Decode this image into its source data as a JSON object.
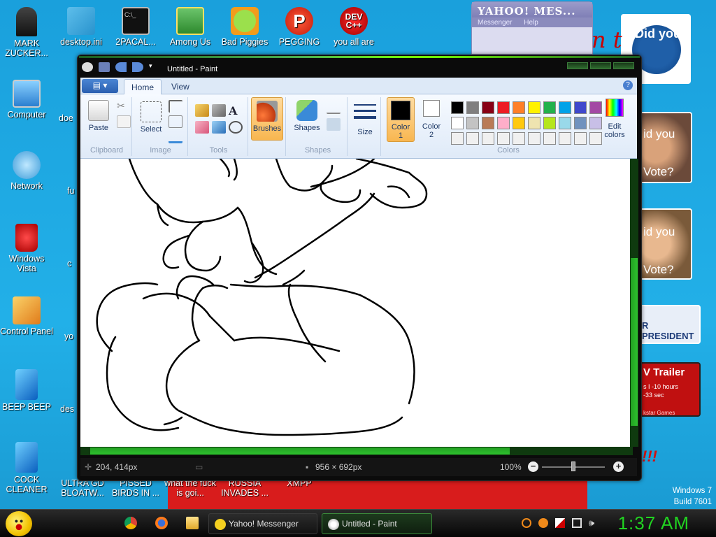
{
  "desktop": {
    "icons": [
      {
        "label": "MARK ZUCKER...",
        "icon": "user-icon"
      },
      {
        "label": "desktop.ini",
        "icon": "file-icon"
      },
      {
        "label": "2PACAL...",
        "icon": "console-icon"
      },
      {
        "label": "Among Us",
        "icon": "game-icon"
      },
      {
        "label": "Bad Piggies",
        "icon": "pig-icon"
      },
      {
        "label": "PEGGING",
        "icon": "p-icon"
      },
      {
        "label": "you all are",
        "icon": "devcpp-icon"
      },
      {
        "label": "Computer",
        "icon": "computer-icon"
      },
      {
        "label": "Network",
        "icon": "network-icon"
      },
      {
        "label": "Windows Vista",
        "icon": "recycle-bin-icon"
      },
      {
        "label": "Control Panel",
        "icon": "control-panel-icon"
      },
      {
        "label": "BEEP BEEP",
        "icon": "blue-file-icon"
      },
      {
        "label": "COCK CLEANER",
        "icon": "blue-file-icon"
      }
    ],
    "partial_icons": [
      {
        "label": "doe"
      },
      {
        "label": "fu"
      },
      {
        "label": "c"
      },
      {
        "label": "yo"
      },
      {
        "label": "des"
      }
    ],
    "bottom_labels": [
      "ULTRA GD BLOATW...",
      "PISSED BIRDS IN ...",
      "what the fuck is goi...",
      "RUSSIA INVADES ...",
      "XMPP"
    ],
    "ads": {
      "did_you_1": "Did you",
      "did_you_2": "id you",
      "vote_2": "Vote?",
      "did_you_3": "id you",
      "vote_3": "Vote?",
      "president": "R PRESIDENT",
      "trailer": "V Trailer",
      "trailer_sub1": "s I -10 hours",
      "trailer_sub2": "-33 sec",
      "trailer_sub3": "kstar Games"
    },
    "watermark": {
      "line1": "Windows 7",
      "line2": "Build 7601"
    }
  },
  "yahoo": {
    "title": "YAHOO! MES...",
    "menu": [
      "Messenger",
      "Help"
    ]
  },
  "paint": {
    "title": "Untitled - Paint",
    "tabs": [
      "Home",
      "View"
    ],
    "groups": {
      "clipboard": {
        "label": "Clipboard",
        "paste": "Paste"
      },
      "image": {
        "label": "Image",
        "select": "Select"
      },
      "tools": {
        "label": "Tools"
      },
      "brushes": {
        "label": "Brushes"
      },
      "shapes": {
        "label": "Shapes",
        "shapes_btn": "Shapes"
      },
      "size": {
        "label": "Size"
      },
      "colors": {
        "label": "Colors",
        "color1_a": "Color",
        "color1_b": "1",
        "color2_a": "Color",
        "color2_b": "2",
        "edit_a": "Edit",
        "edit_b": "colors"
      }
    },
    "palette": [
      "#000000",
      "#7f7f7f",
      "#880015",
      "#ed1c24",
      "#ff7f27",
      "#fff200",
      "#22b14c",
      "#00a2e8",
      "#3f48cc",
      "#a349a4",
      "#ffffff",
      "#c3c3c3",
      "#b97a57",
      "#ffaec9",
      "#ffc90e",
      "#efe4b0",
      "#b5e61d",
      "#99d9ea",
      "#7092be",
      "#c8bfe7",
      "#f0f0f0",
      "#f0f0f0",
      "#f0f0f0",
      "#f0f0f0",
      "#f0f0f0",
      "#f0f0f0",
      "#f0f0f0",
      "#f0f0f0",
      "#f0f0f0",
      "#f0f0f0"
    ],
    "color1": "#000000",
    "color2": "#ffffff",
    "status": {
      "cursor": "204, 414px",
      "canvas_size": "956 × 692px",
      "zoom": "100%"
    }
  },
  "taskbar": {
    "tasks": [
      "Yahoo! Messenger",
      "Untitled - Paint"
    ],
    "clock": "1:37 AM"
  },
  "colors": {
    "accent_green": "#21d421",
    "desktop_blue": "#1fa6df"
  }
}
